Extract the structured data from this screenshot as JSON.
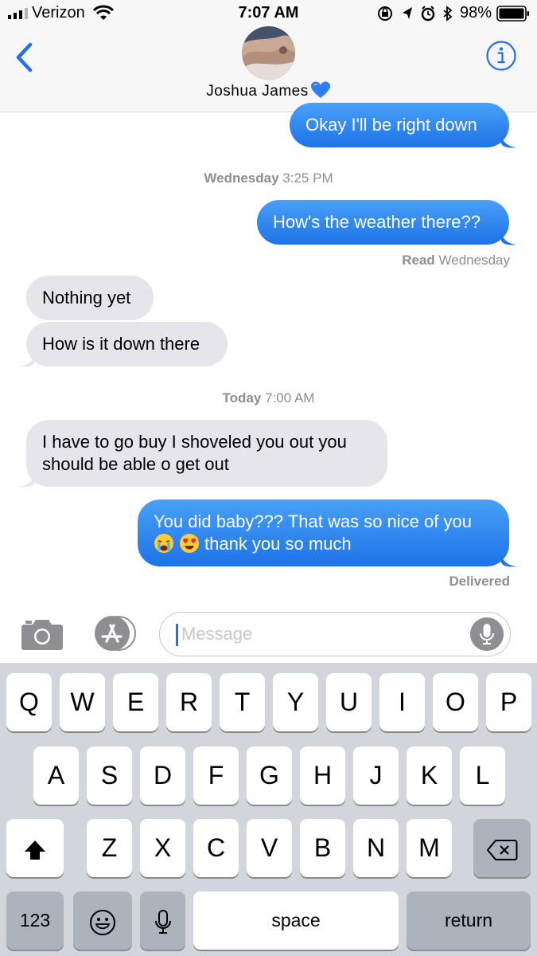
{
  "status_bar": {
    "carrier": "Verizon",
    "time": "7:07 AM",
    "battery": "98%"
  },
  "header": {
    "contact_name": "Joshua James",
    "name_emoji_icon": "blue-heart-icon"
  },
  "messages": [
    {
      "direction": "sent",
      "text": "Okay I'll be right down"
    },
    {
      "type": "timestamp",
      "day": "Wednesday",
      "time": "3:25 PM"
    },
    {
      "direction": "sent",
      "text": "How's the weather there??"
    },
    {
      "type": "receipt",
      "status": "Read",
      "detail": "Wednesday"
    },
    {
      "direction": "received",
      "text": "Nothing yet"
    },
    {
      "direction": "received",
      "text": "How is it down there"
    },
    {
      "type": "timestamp",
      "day": "Today",
      "time": "7:00 AM"
    },
    {
      "direction": "received",
      "line1": "I have to go buy I shoveled you out you",
      "line2": "should be able o get out"
    },
    {
      "direction": "sent",
      "line1": "You did baby??? That was so nice of you",
      "line2": "thank you so much",
      "emojis": [
        "crying-face-icon",
        "heart-eyes-icon"
      ]
    },
    {
      "type": "receipt",
      "status": "Delivered"
    }
  ],
  "compose": {
    "placeholder": "Message"
  },
  "keyboard": {
    "row1": [
      "Q",
      "W",
      "E",
      "R",
      "T",
      "Y",
      "U",
      "I",
      "O",
      "P"
    ],
    "row2": [
      "A",
      "S",
      "D",
      "F",
      "G",
      "H",
      "J",
      "K",
      "L"
    ],
    "row3": [
      "Z",
      "X",
      "C",
      "V",
      "B",
      "N",
      "M"
    ],
    "numbers_label": "123",
    "space_label": "space",
    "return_label": "return"
  },
  "colors": {
    "ios_blue": "#2f85ea",
    "received_bubble": "#e6e5eb",
    "keyboard_bg": "#d2d5db"
  }
}
